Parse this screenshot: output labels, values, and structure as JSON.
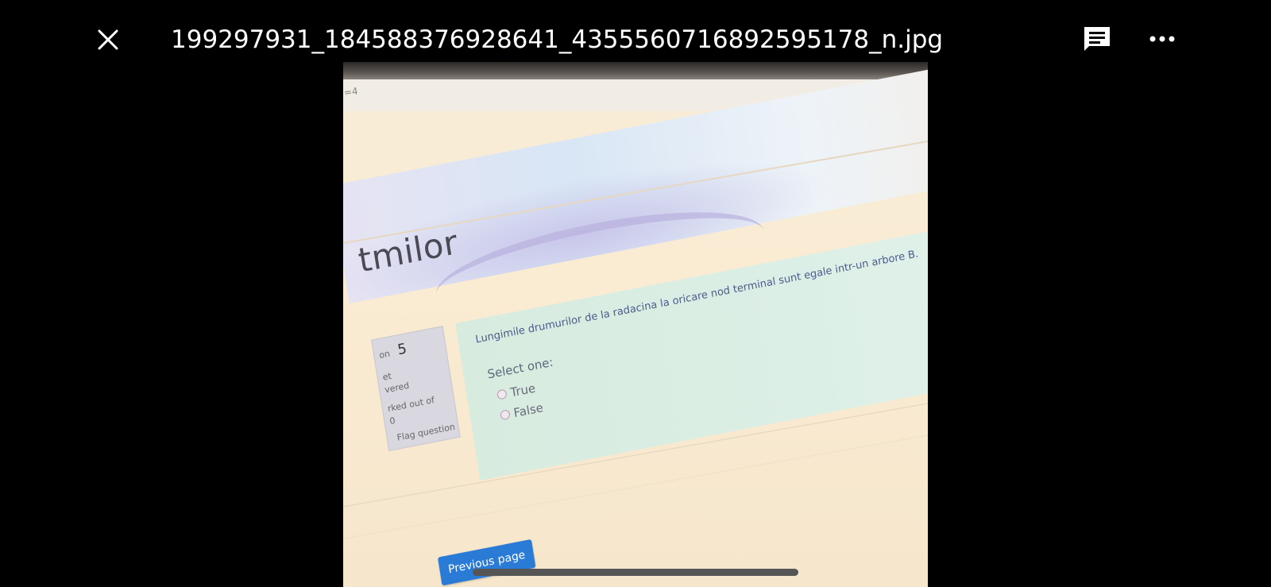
{
  "viewer": {
    "filename": "199297931_184588376928641_4355560716892595178_n.jpg"
  },
  "photo": {
    "url_fragment": "=4",
    "course_title": "tmilor",
    "info": {
      "number_prefix": "on",
      "number": "5",
      "line1": "et",
      "line2": "vered",
      "line3": "rked out of",
      "line4": "0",
      "flag_label": "Flag question"
    },
    "question": {
      "text": "Lungimile drumurilor de la radacina la oricare nod terminal sunt egale intr-un arbore B.",
      "select_label": "Select one:",
      "options": [
        "True",
        "False"
      ]
    },
    "previous_button": "Previous page"
  },
  "colors": {
    "background": "#000000",
    "button_blue": "#2a7bd6",
    "question_bg": "#d7ebdf",
    "page_bg": "#faecd3"
  }
}
